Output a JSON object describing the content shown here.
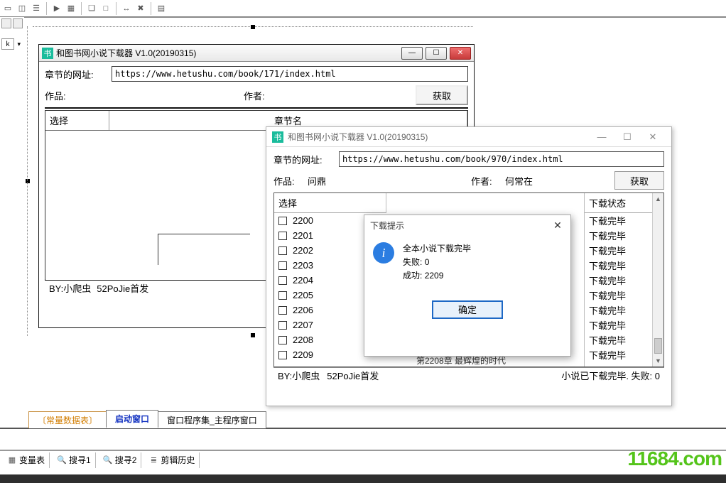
{
  "top_toolbar_icons": [
    "[]",
    "◫",
    "≡",
    "▶",
    "▦",
    "|",
    "❏",
    "□",
    "|",
    "↔",
    "✖",
    "|",
    "▤"
  ],
  "left_vert_label": "k",
  "win1": {
    "title": "和图书网小说下载器 V1.0(20190315)",
    "app_icon_char": "书",
    "url_label": "章节的网址:",
    "url_value": "https://www.hetushu.com/book/171/index.html",
    "book_label": "作品:",
    "author_label": "作者:",
    "get_btn": "获取",
    "col_select": "选择",
    "col_chapter": "章节名",
    "status_by": "BY:小爬虫",
    "status_src": "52PoJie首发",
    "winbtns": {
      "min": "—",
      "max": "☐",
      "close": "✕"
    }
  },
  "win2": {
    "title": "和图书网小说下载器 V1.0(20190315)",
    "app_icon_char": "书",
    "url_label": "章节的网址:",
    "url_value": "https://www.hetushu.com/book/970/index.html",
    "book_label": "作品:",
    "book_value": "问鼎",
    "author_label": "作者:",
    "author_value": "何常在",
    "get_btn": "获取",
    "col_select": "选择",
    "col_status": "下载状态",
    "rows": [
      "2200",
      "2201",
      "2202",
      "2203",
      "2204",
      "2205",
      "2206",
      "2207",
      "2208",
      "2209"
    ],
    "row_status": "下载完毕",
    "chapter_peek": "第2208章 最辉煌的时代",
    "status_by": "BY:小爬虫",
    "status_src": "52PoJie首发",
    "status_right": "小说已下载完毕. 失败: 0",
    "winbtns": {
      "min": "—",
      "max": "☐",
      "close": "✕"
    }
  },
  "dialog": {
    "title": "下载提示",
    "close": "✕",
    "line1": "全本小说下载完毕",
    "line2_label": "失败:",
    "line2_value": "0",
    "line3_label": "成功:",
    "line3_value": "2209",
    "ok": "确定"
  },
  "bottom_tabs": {
    "tab1": "常量数据表",
    "tab2": "启动窗口",
    "tab3": "窗口程序集_主程序窗口"
  },
  "bottom_toolbar": {
    "seg1": "变量表",
    "seg2": "搜寻1",
    "seg3": "搜寻2",
    "seg4": "剪辑历史"
  },
  "watermark": "11684.com"
}
